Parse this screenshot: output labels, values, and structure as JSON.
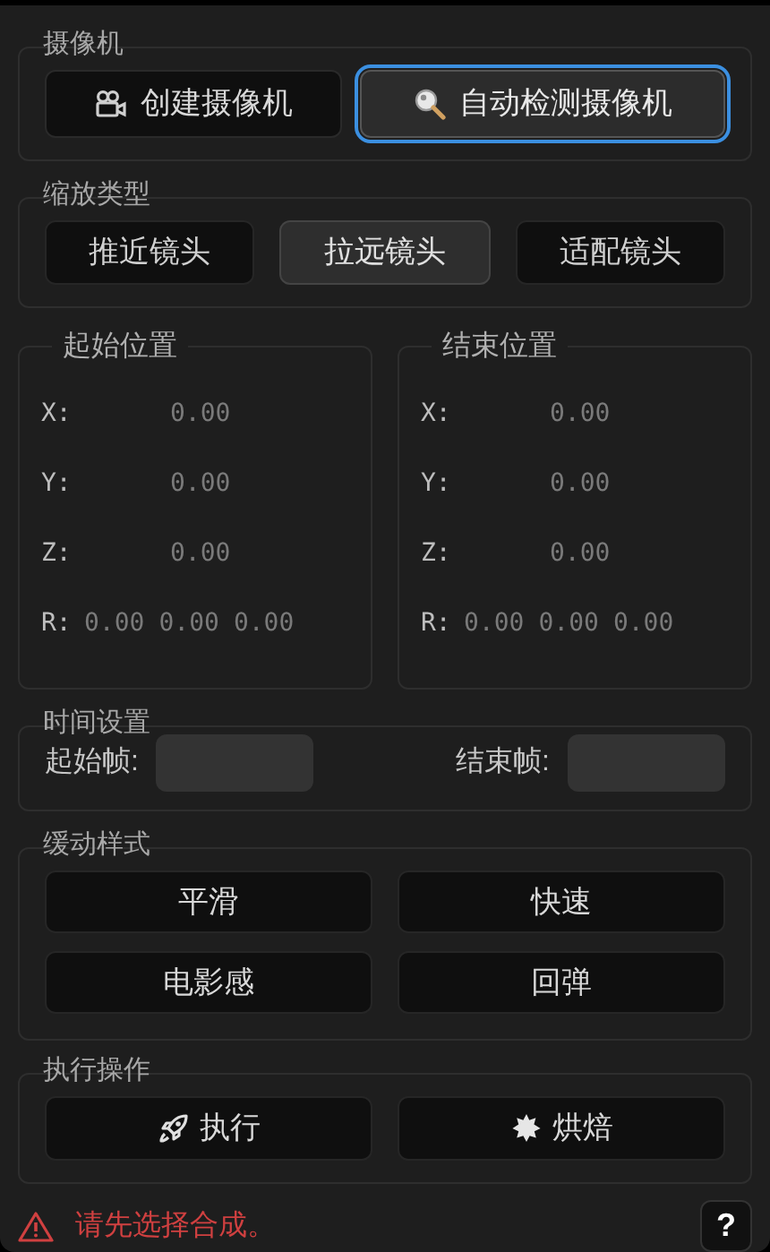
{
  "camera": {
    "title": "摄像机",
    "buttons": [
      {
        "label": "创建摄像机",
        "focused": false
      },
      {
        "label": "自动检测摄像机",
        "focused": true
      }
    ]
  },
  "zoom_type": {
    "title": "缩放类型",
    "options": [
      {
        "label": "推近镜头",
        "selected": false
      },
      {
        "label": "拉远镜头",
        "selected": true
      },
      {
        "label": "适配镜头",
        "selected": false
      }
    ]
  },
  "positions": [
    {
      "title": "起始位置",
      "rows": [
        {
          "label": "X:",
          "values": [
            "0.00"
          ]
        },
        {
          "label": "Y:",
          "values": [
            "0.00"
          ]
        },
        {
          "label": "Z:",
          "values": [
            "0.00"
          ]
        },
        {
          "label": "R:",
          "values": [
            "0.00",
            "0.00",
            "0.00"
          ]
        }
      ]
    },
    {
      "title": "结束位置",
      "rows": [
        {
          "label": "X:",
          "values": [
            "0.00"
          ]
        },
        {
          "label": "Y:",
          "values": [
            "0.00"
          ]
        },
        {
          "label": "Z:",
          "values": [
            "0.00"
          ]
        },
        {
          "label": "R:",
          "values": [
            "0.00",
            "0.00",
            "0.00"
          ]
        }
      ]
    }
  ],
  "time": {
    "title": "时间设置",
    "start_label": "起始帧:",
    "end_label": "结束帧:"
  },
  "easing": {
    "title": "缓动样式",
    "options": [
      "平滑",
      "快速",
      "电影感",
      "回弹"
    ]
  },
  "actions": {
    "title": "执行操作",
    "buttons": [
      "执行",
      "烘焙"
    ]
  },
  "footer": {
    "warning": "请先选择合成。",
    "help": "?"
  }
}
